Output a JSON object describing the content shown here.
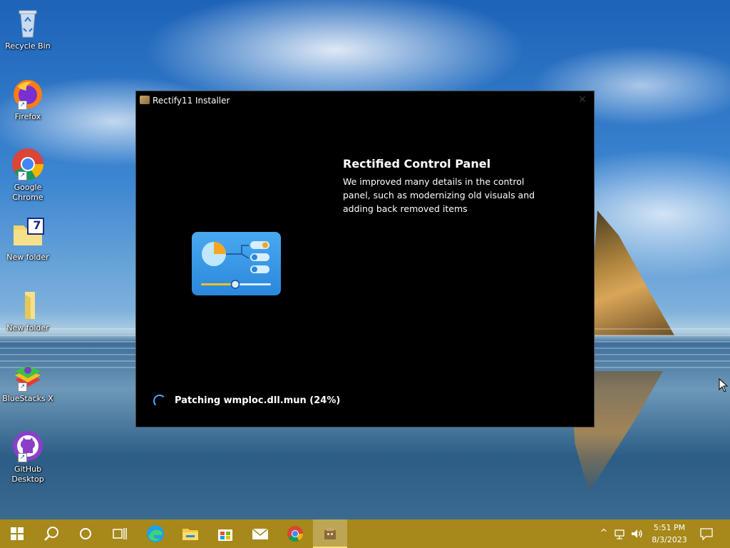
{
  "desktop": {
    "icons": [
      {
        "name": "recycle-bin-icon",
        "label": "Recycle Bin"
      },
      {
        "name": "firefox-icon",
        "label": "Firefox"
      },
      {
        "name": "google-chrome-icon",
        "label": "Google Chrome"
      },
      {
        "name": "winrar-folder-icon",
        "label": "New folder",
        "badge": "7"
      },
      {
        "name": "folder-icon",
        "label": "New folder"
      },
      {
        "name": "bluestacks-icon",
        "label": "BlueStacks X"
      },
      {
        "name": "github-desktop-icon",
        "label": "GitHub Desktop"
      }
    ]
  },
  "window": {
    "title": "Rectify11 Installer",
    "close_glyph": "✕",
    "feature": {
      "title": "Rectified Control Panel",
      "description": "We improved many details in the control panel, such as modernizing old visuals and adding back removed items"
    },
    "status": "Patching wmploc.dll.mun (24%)",
    "progress_percent": 24
  },
  "taskbar": {
    "apps": [
      "start-icon",
      "search-icon",
      "cortana-icon",
      "task-view-icon",
      "edge-icon",
      "file-explorer-icon",
      "store-icon",
      "mail-icon",
      "chrome-icon",
      "rectify11-installer-icon"
    ],
    "tray": {
      "chevron": "^",
      "network": "network-icon",
      "volume": "volume-icon"
    },
    "clock_time": "5:51 PM",
    "clock_date": "8/3/2023"
  },
  "colors": {
    "taskbar": "#a7881a",
    "window_bg": "#000000",
    "accent": "#2b87dd"
  }
}
